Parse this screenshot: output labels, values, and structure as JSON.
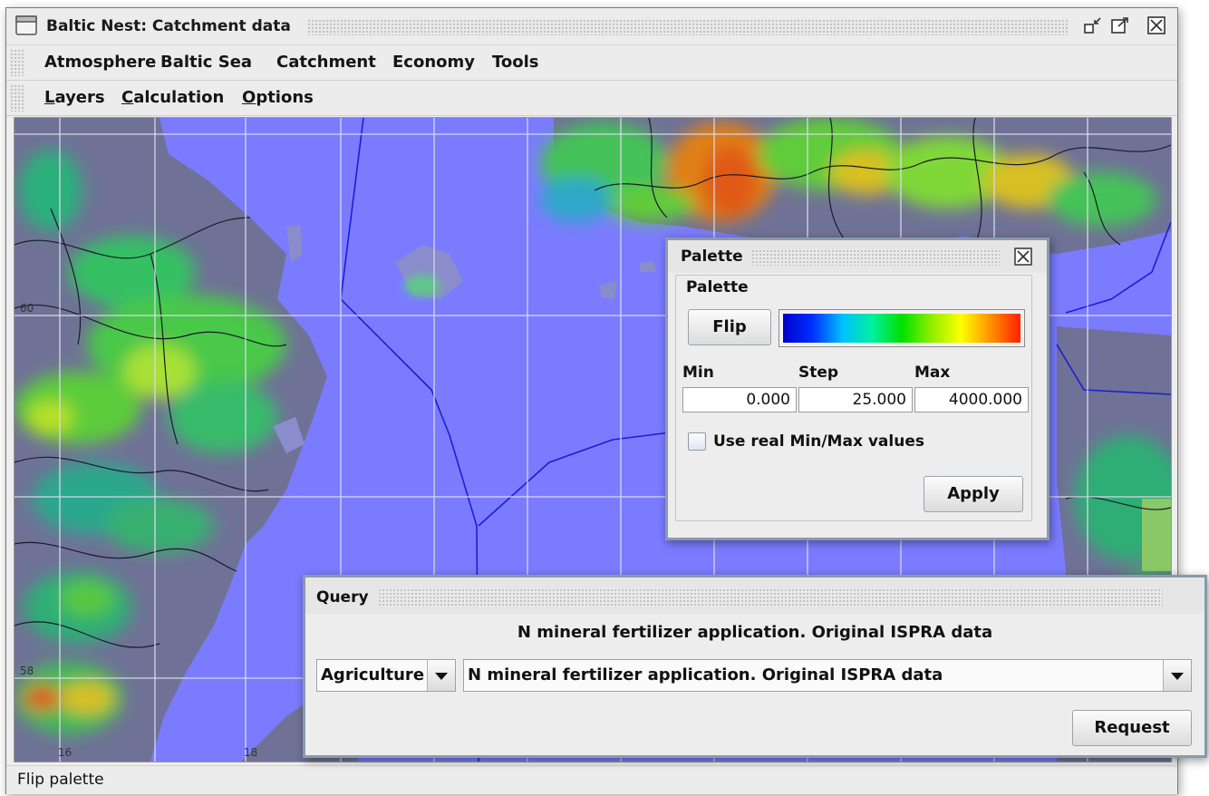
{
  "window": {
    "title": "Baltic Nest: Catchment data",
    "menus": [
      "Atmosphere",
      "Baltic Sea",
      "Catchment",
      "Economy",
      "Tools"
    ],
    "submenus": [
      {
        "mnemonic": "L",
        "rest": "ayers"
      },
      {
        "mnemonic": "C",
        "rest": "alculation"
      },
      {
        "mnemonic": "O",
        "rest": "ptions"
      }
    ],
    "status": "Flip palette"
  },
  "map": {
    "latitude_labels": [
      "60",
      "58"
    ],
    "longitude_labels": [
      "16",
      "18"
    ],
    "colors": {
      "sea": "#7b7bff",
      "land": "#6f7296",
      "grid": "#d8d8e8",
      "border": "#1a1a2a"
    }
  },
  "palette_dialog": {
    "title": "Palette",
    "group_label": "Palette",
    "flip_label": "Flip",
    "min_label": "Min",
    "step_label": "Step",
    "max_label": "Max",
    "min_value": "0.000",
    "step_value": "25.000",
    "max_value": "4000.000",
    "use_real_label": "Use real Min/Max values",
    "use_real_checked": false,
    "apply_label": "Apply"
  },
  "query_dialog": {
    "title": "Query",
    "heading": "N mineral fertilizer application. Original ISPRA data",
    "category_value": "Agriculture",
    "dataset_value": "N mineral fertilizer application. Original ISPRA data",
    "request_label": "Request"
  }
}
